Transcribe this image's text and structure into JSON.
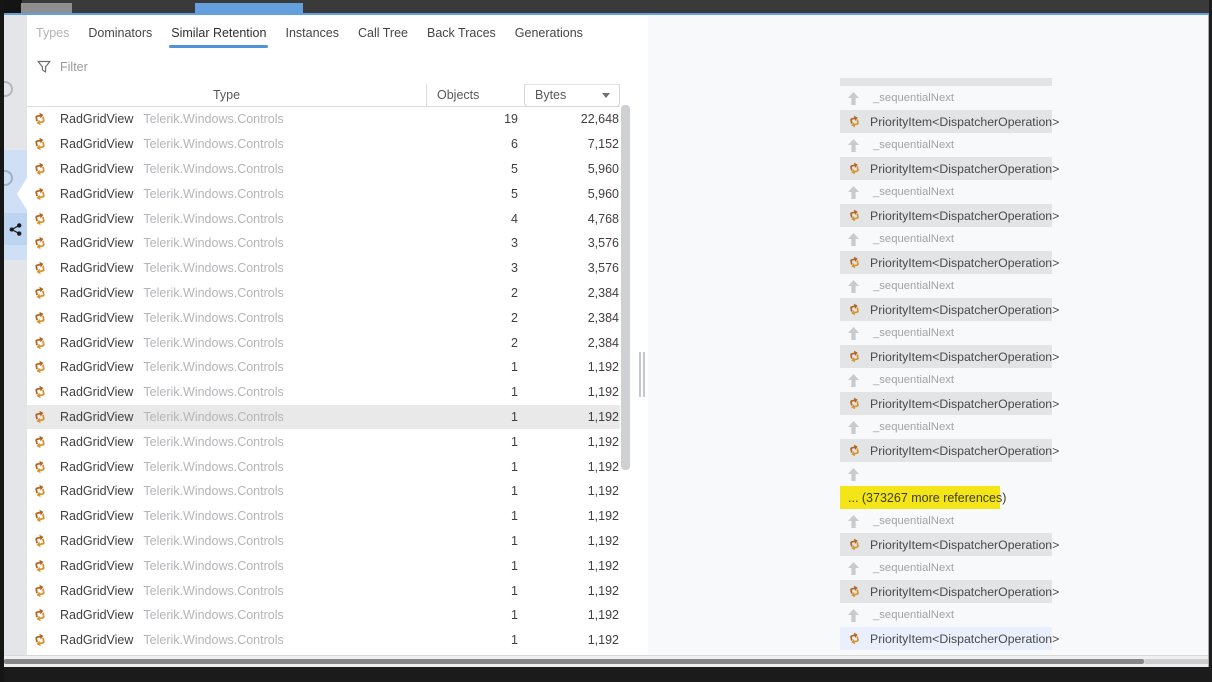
{
  "tabs": [
    {
      "id": "types",
      "label": "Types",
      "state": "disabled"
    },
    {
      "id": "dominators",
      "label": "Dominators",
      "state": "normal"
    },
    {
      "id": "similar-retention",
      "label": "Similar Retention",
      "state": "active"
    },
    {
      "id": "instances",
      "label": "Instances",
      "state": "normal"
    },
    {
      "id": "call-tree",
      "label": "Call Tree",
      "state": "normal"
    },
    {
      "id": "back-traces",
      "label": "Back Traces",
      "state": "normal"
    },
    {
      "id": "generations",
      "label": "Generations",
      "state": "normal"
    }
  ],
  "filter": {
    "placeholder": "Filter"
  },
  "table": {
    "columns": {
      "type": "Type",
      "objects": "Objects",
      "bytes": "Bytes"
    },
    "rows": [
      {
        "type": "RadGridView",
        "namespace": "Telerik.Windows.Controls",
        "objects": "19",
        "bytes": "22,648",
        "selected": false
      },
      {
        "type": "RadGridView",
        "namespace": "Telerik.Windows.Controls",
        "objects": "6",
        "bytes": "7,152",
        "selected": false
      },
      {
        "type": "RadGridView",
        "namespace": "Telerik.Windows.Controls",
        "objects": "5",
        "bytes": "5,960",
        "selected": false
      },
      {
        "type": "RadGridView",
        "namespace": "Telerik.Windows.Controls",
        "objects": "5",
        "bytes": "5,960",
        "selected": false
      },
      {
        "type": "RadGridView",
        "namespace": "Telerik.Windows.Controls",
        "objects": "4",
        "bytes": "4,768",
        "selected": false
      },
      {
        "type": "RadGridView",
        "namespace": "Telerik.Windows.Controls",
        "objects": "3",
        "bytes": "3,576",
        "selected": false
      },
      {
        "type": "RadGridView",
        "namespace": "Telerik.Windows.Controls",
        "objects": "3",
        "bytes": "3,576",
        "selected": false
      },
      {
        "type": "RadGridView",
        "namespace": "Telerik.Windows.Controls",
        "objects": "2",
        "bytes": "2,384",
        "selected": false
      },
      {
        "type": "RadGridView",
        "namespace": "Telerik.Windows.Controls",
        "objects": "2",
        "bytes": "2,384",
        "selected": false
      },
      {
        "type": "RadGridView",
        "namespace": "Telerik.Windows.Controls",
        "objects": "2",
        "bytes": "2,384",
        "selected": false
      },
      {
        "type": "RadGridView",
        "namespace": "Telerik.Windows.Controls",
        "objects": "1",
        "bytes": "1,192",
        "selected": false
      },
      {
        "type": "RadGridView",
        "namespace": "Telerik.Windows.Controls",
        "objects": "1",
        "bytes": "1,192",
        "selected": false
      },
      {
        "type": "RadGridView",
        "namespace": "Telerik.Windows.Controls",
        "objects": "1",
        "bytes": "1,192",
        "selected": true
      },
      {
        "type": "RadGridView",
        "namespace": "Telerik.Windows.Controls",
        "objects": "1",
        "bytes": "1,192",
        "selected": false
      },
      {
        "type": "RadGridView",
        "namespace": "Telerik.Windows.Controls",
        "objects": "1",
        "bytes": "1,192",
        "selected": false
      },
      {
        "type": "RadGridView",
        "namespace": "Telerik.Windows.Controls",
        "objects": "1",
        "bytes": "1,192",
        "selected": false
      },
      {
        "type": "RadGridView",
        "namespace": "Telerik.Windows.Controls",
        "objects": "1",
        "bytes": "1,192",
        "selected": false
      },
      {
        "type": "RadGridView",
        "namespace": "Telerik.Windows.Controls",
        "objects": "1",
        "bytes": "1,192",
        "selected": false
      },
      {
        "type": "RadGridView",
        "namespace": "Telerik.Windows.Controls",
        "objects": "1",
        "bytes": "1,192",
        "selected": false
      },
      {
        "type": "RadGridView",
        "namespace": "Telerik.Windows.Controls",
        "objects": "1",
        "bytes": "1,192",
        "selected": false
      },
      {
        "type": "RadGridView",
        "namespace": "Telerik.Windows.Controls",
        "objects": "1",
        "bytes": "1,192",
        "selected": false
      },
      {
        "type": "RadGridView",
        "namespace": "Telerik.Windows.Controls",
        "objects": "1",
        "bytes": "1,192",
        "selected": false
      }
    ]
  },
  "retention_graph": {
    "items": [
      {
        "kind": "object-partial",
        "label": ""
      },
      {
        "kind": "reference",
        "label": "_sequentialNext"
      },
      {
        "kind": "object",
        "label": "PriorityItem<DispatcherOperation>",
        "selected": false
      },
      {
        "kind": "reference",
        "label": "_sequentialNext"
      },
      {
        "kind": "object",
        "label": "PriorityItem<DispatcherOperation>",
        "selected": false
      },
      {
        "kind": "reference",
        "label": "_sequentialNext"
      },
      {
        "kind": "object",
        "label": "PriorityItem<DispatcherOperation>",
        "selected": false
      },
      {
        "kind": "reference",
        "label": "_sequentialNext"
      },
      {
        "kind": "object",
        "label": "PriorityItem<DispatcherOperation>",
        "selected": false
      },
      {
        "kind": "reference",
        "label": "_sequentialNext"
      },
      {
        "kind": "object",
        "label": "PriorityItem<DispatcherOperation>",
        "selected": false
      },
      {
        "kind": "reference",
        "label": "_sequentialNext"
      },
      {
        "kind": "object",
        "label": "PriorityItem<DispatcherOperation>",
        "selected": false
      },
      {
        "kind": "reference",
        "label": "_sequentialNext"
      },
      {
        "kind": "object",
        "label": "PriorityItem<DispatcherOperation>",
        "selected": false
      },
      {
        "kind": "reference",
        "label": "_sequentialNext"
      },
      {
        "kind": "object",
        "label": "PriorityItem<DispatcherOperation>",
        "selected": false
      },
      {
        "kind": "reference",
        "label": ""
      },
      {
        "kind": "more",
        "label": "... (373267 more references)"
      },
      {
        "kind": "reference",
        "label": "_sequentialNext"
      },
      {
        "kind": "object",
        "label": "PriorityItem<DispatcherOperation>",
        "selected": false
      },
      {
        "kind": "reference",
        "label": "_sequentialNext"
      },
      {
        "kind": "object",
        "label": "PriorityItem<DispatcherOperation>",
        "selected": false
      },
      {
        "kind": "reference",
        "label": "_sequentialNext"
      },
      {
        "kind": "object",
        "label": "PriorityItem<DispatcherOperation>",
        "selected": true
      }
    ]
  },
  "colors": {
    "accent_blue": "#63a0dd",
    "tab_underline_blue": "#4f94d6",
    "highlight_yellow": "#f4e519",
    "icon_orange": "#c87f2f",
    "rail_selection_blue": "#cfe0f6",
    "object_box_gray": "#e3e4e6",
    "selected_object_blue": "#e9effc"
  }
}
